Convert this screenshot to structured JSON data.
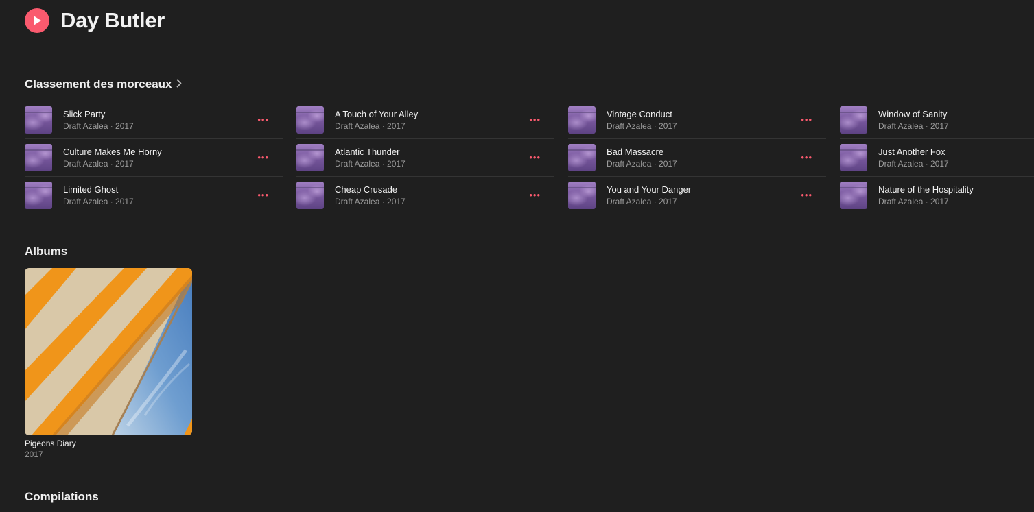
{
  "artist": {
    "name": "Day Butler"
  },
  "top_songs": {
    "heading": "Classement des morceaux",
    "more_label": "•••",
    "columns": [
      [
        {
          "title": "Slick Party",
          "subtitle": "Draft Azalea · 2017"
        },
        {
          "title": "Culture Makes Me Horny",
          "subtitle": "Draft Azalea · 2017"
        },
        {
          "title": "Limited Ghost",
          "subtitle": "Draft Azalea · 2017"
        }
      ],
      [
        {
          "title": "A Touch of Your Alley",
          "subtitle": "Draft Azalea · 2017"
        },
        {
          "title": "Atlantic Thunder",
          "subtitle": "Draft Azalea · 2017"
        },
        {
          "title": "Cheap Crusade",
          "subtitle": "Draft Azalea · 2017"
        }
      ],
      [
        {
          "title": "Vintage Conduct",
          "subtitle": "Draft Azalea · 2017"
        },
        {
          "title": "Bad Massacre",
          "subtitle": "Draft Azalea · 2017"
        },
        {
          "title": "You and Your Danger",
          "subtitle": "Draft Azalea · 2017"
        }
      ],
      [
        {
          "title": "Window of Sanity",
          "subtitle": "Draft Azalea · 2017"
        },
        {
          "title": "Just Another Fox",
          "subtitle": "Draft Azalea · 2017"
        },
        {
          "title": "Nature of the Hospitality",
          "subtitle": "Draft Azalea · 2017"
        }
      ]
    ]
  },
  "albums": {
    "heading": "Albums",
    "items": [
      {
        "title": "Pigeons Diary",
        "year": "2017"
      }
    ]
  },
  "compilations": {
    "heading": "Compilations"
  },
  "colors": {
    "background": "#1f1f1f",
    "accent": "#fa5a6e",
    "divider": "#343434",
    "secondary_text": "#9c9c9c"
  },
  "icons": {
    "play": "play-icon",
    "chevron": "chevron-right-icon",
    "more": "more-icon"
  }
}
